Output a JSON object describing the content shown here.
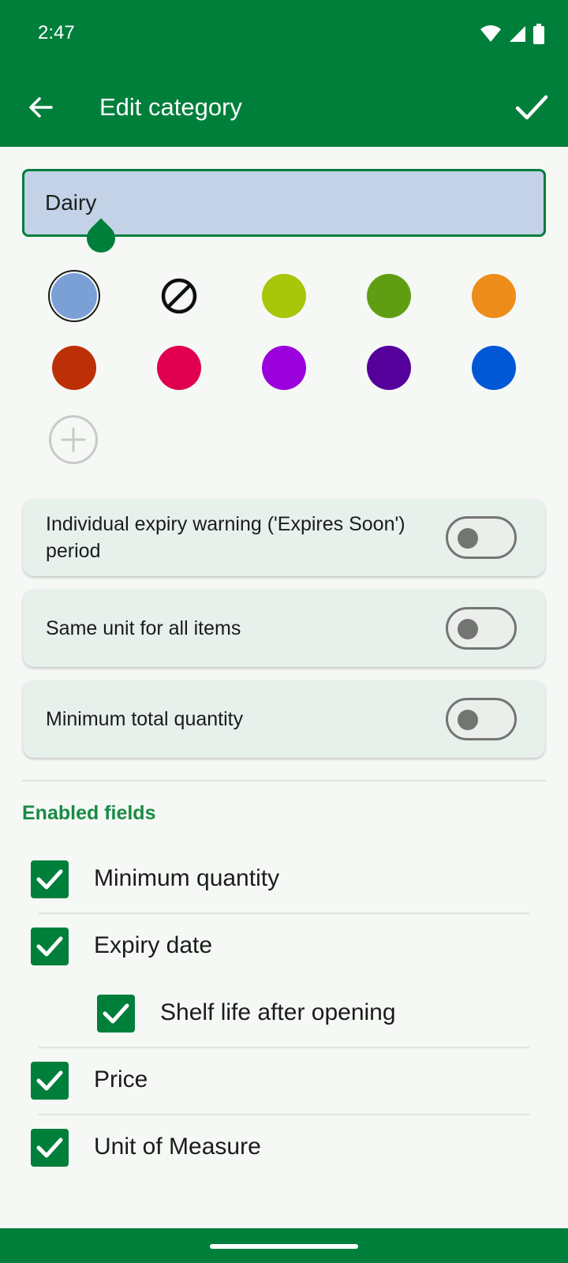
{
  "status_bar": {
    "time": "2:47",
    "icons": [
      "wifi-icon",
      "signal-icon",
      "battery-icon"
    ]
  },
  "app_bar": {
    "title": "Edit category",
    "back_icon": "arrow-left-icon",
    "confirm_icon": "check-icon"
  },
  "name_field": {
    "value": "Dairy"
  },
  "colors": {
    "selected": "#7aa0d6",
    "palette": [
      "#7aa0d6",
      "none",
      "#a8c60a",
      "#5f9e12",
      "#ee8c1a",
      "#bd2f06",
      "#e0004f",
      "#9a00dc",
      "#56009c",
      "#0058d6"
    ]
  },
  "settings": [
    {
      "label": "Individual expiry warning ('Expires Soon') period",
      "enabled": false
    },
    {
      "label": "Same unit for all items",
      "enabled": false
    },
    {
      "label": "Minimum total quantity",
      "enabled": false
    }
  ],
  "enabled_fields": {
    "title": "Enabled fields",
    "items": [
      {
        "label": "Minimum quantity",
        "checked": true
      },
      {
        "label": "Expiry date",
        "checked": true
      },
      {
        "label": "Shelf life after opening",
        "checked": true
      },
      {
        "label": "Price",
        "checked": true
      },
      {
        "label": "Unit of Measure",
        "checked": true
      }
    ]
  },
  "theme": {
    "primary": "#007f3b",
    "accent_text": "#1a8a45"
  }
}
